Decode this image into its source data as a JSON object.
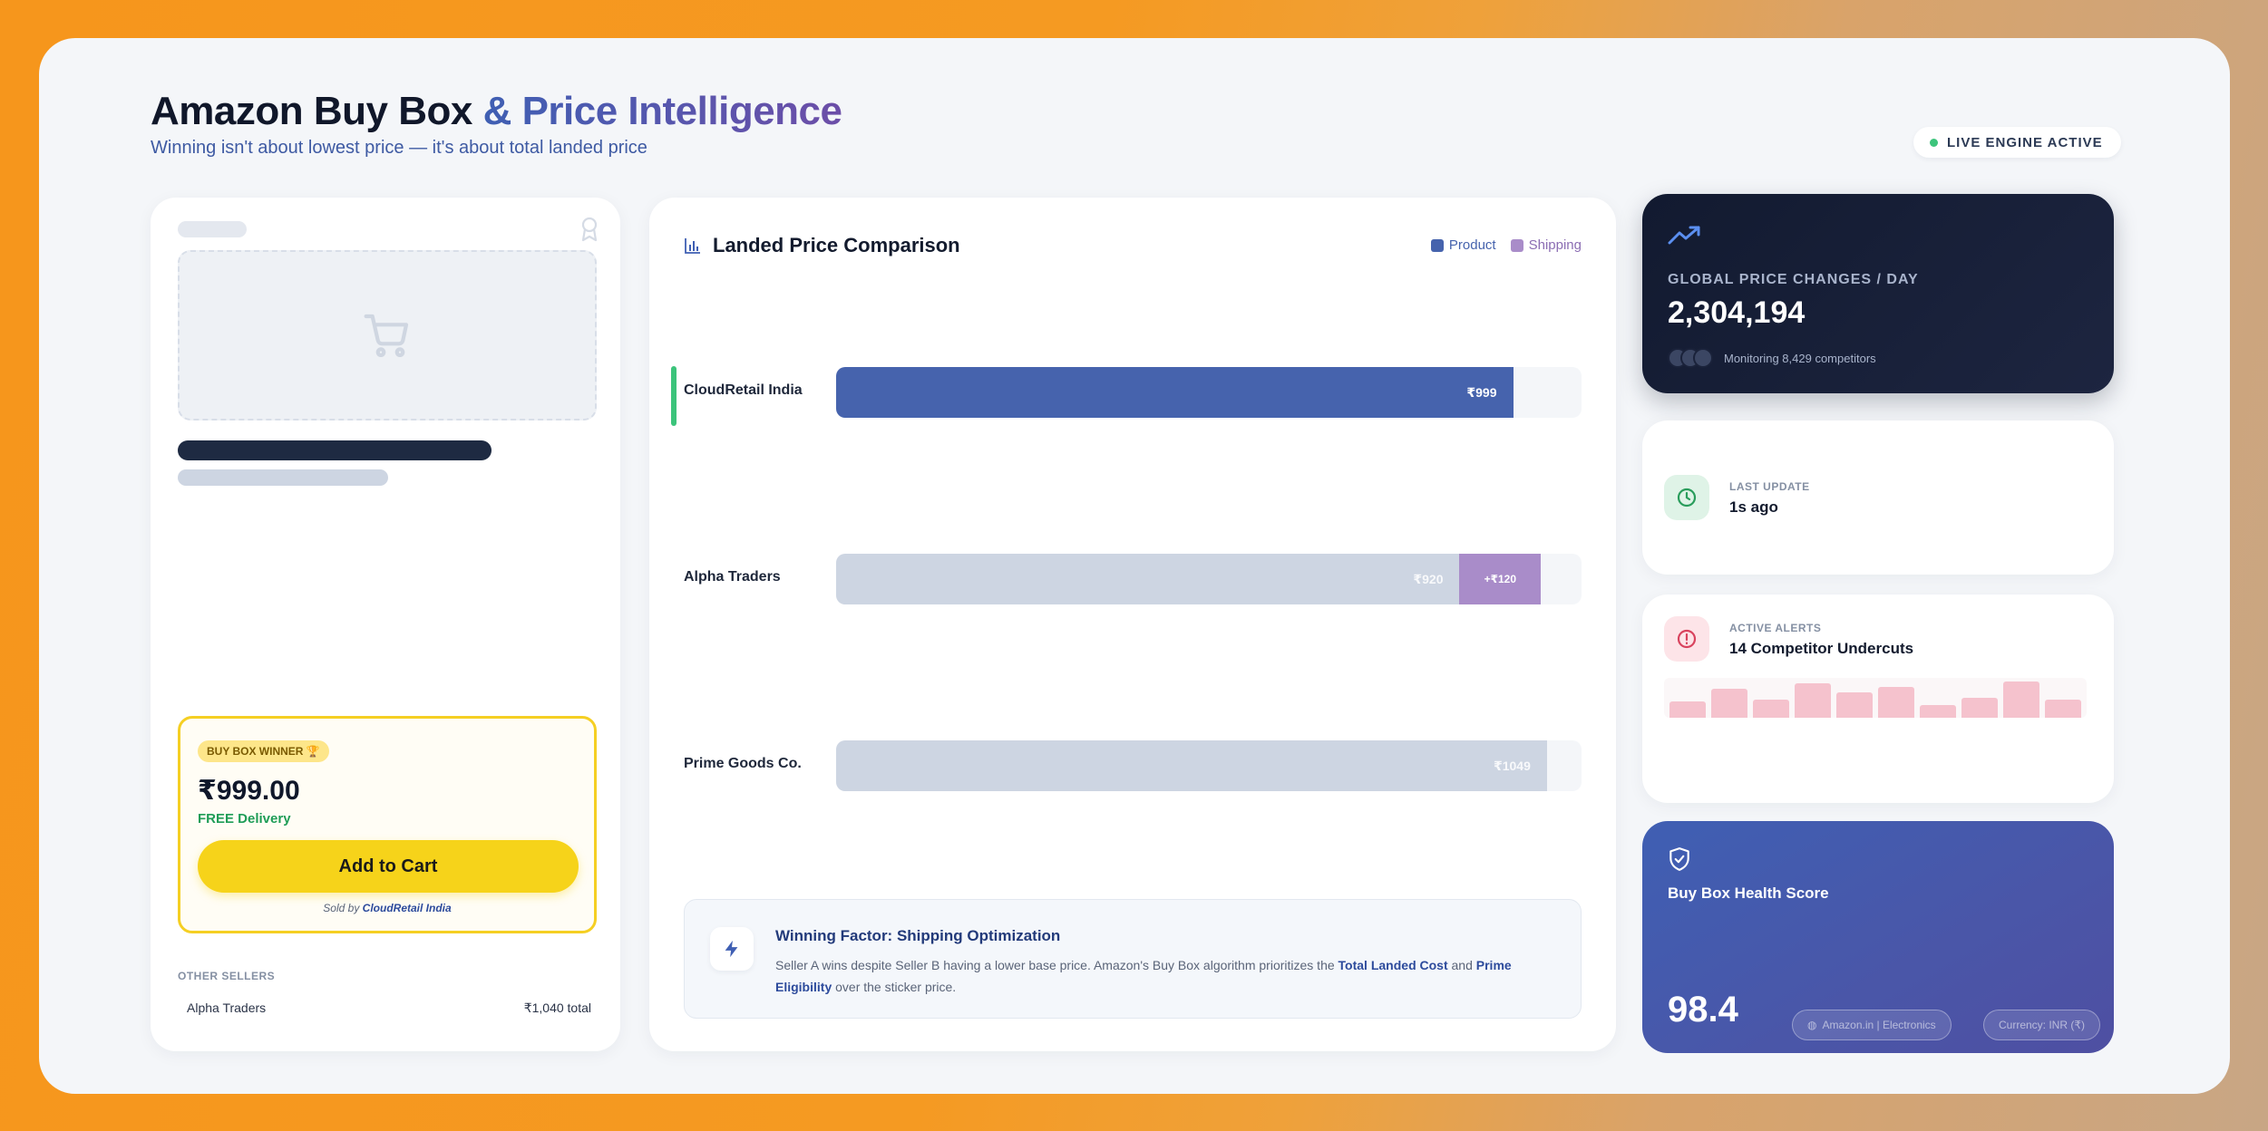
{
  "header": {
    "title_main": "Amazon Buy Box",
    "title_accent": "& Price Intelligence",
    "subtitle": "Winning isn't about lowest price — it's about total landed price",
    "live_badge": "LIVE ENGINE ACTIVE"
  },
  "product_card": {
    "winner_badge": "BUY BOX WINNER 🏆",
    "price": "₹999.00",
    "delivery": "FREE Delivery",
    "add_to_cart": "Add to Cart",
    "sold_by_prefix": "Sold by",
    "sold_by_seller": "CloudRetail India",
    "other_sellers_label": "OTHER SELLERS",
    "other_sellers": [
      {
        "name": "Alpha Traders",
        "price": "₹1,040 total"
      }
    ]
  },
  "comparison": {
    "title": "Landed Price Comparison",
    "legend": [
      {
        "label": "Product",
        "color": "#4663ad"
      },
      {
        "label": "Shipping",
        "color": "#a98cc9"
      }
    ],
    "rows": [
      {
        "seller": "CloudRetail India",
        "product": 999,
        "shipping": 0,
        "product_label": "₹999",
        "shipping_label": "",
        "winner": true
      },
      {
        "seller": "Alpha Traders",
        "product": 920,
        "shipping": 120,
        "product_label": "₹920",
        "shipping_label": "+₹120",
        "winner": false
      },
      {
        "seller": "Prime Goods Co.",
        "product": 1049,
        "shipping": 0,
        "product_label": "₹1049",
        "shipping_label": "",
        "winner": false
      }
    ],
    "scale_max": 1100,
    "factor_title": "Winning Factor: Shipping Optimization",
    "factor_text_1": "Seller A wins despite Seller B having a lower base price. Amazon's Buy Box algorithm prioritizes the ",
    "factor_bold_1": "Total Landed Cost",
    "factor_text_2": " and ",
    "factor_bold_2": "Prime Eligibility",
    "factor_text_3": " over the sticker price."
  },
  "global_card": {
    "label": "GLOBAL PRICE CHANGES / DAY",
    "value": "2,304,194",
    "monitoring": "Monitoring 8,429 competitors"
  },
  "last_update": {
    "label": "LAST UPDATE",
    "value": "1s ago"
  },
  "alerts": {
    "label": "ACTIVE ALERTS",
    "value": "14 Competitor Undercuts",
    "sparkline": [
      0.45,
      0.8,
      0.5,
      0.95,
      0.7,
      0.85,
      0.35,
      0.55,
      1.0,
      0.5
    ]
  },
  "health": {
    "label": "Buy Box Health Score",
    "value": "98.4",
    "marketplace": "Amazon.in | Electronics",
    "currency": "Currency: INR (₹)"
  },
  "colors": {
    "product_winner": "#4663ad",
    "product_other": "#cdd5e2",
    "shipping": "#a98cc9"
  }
}
